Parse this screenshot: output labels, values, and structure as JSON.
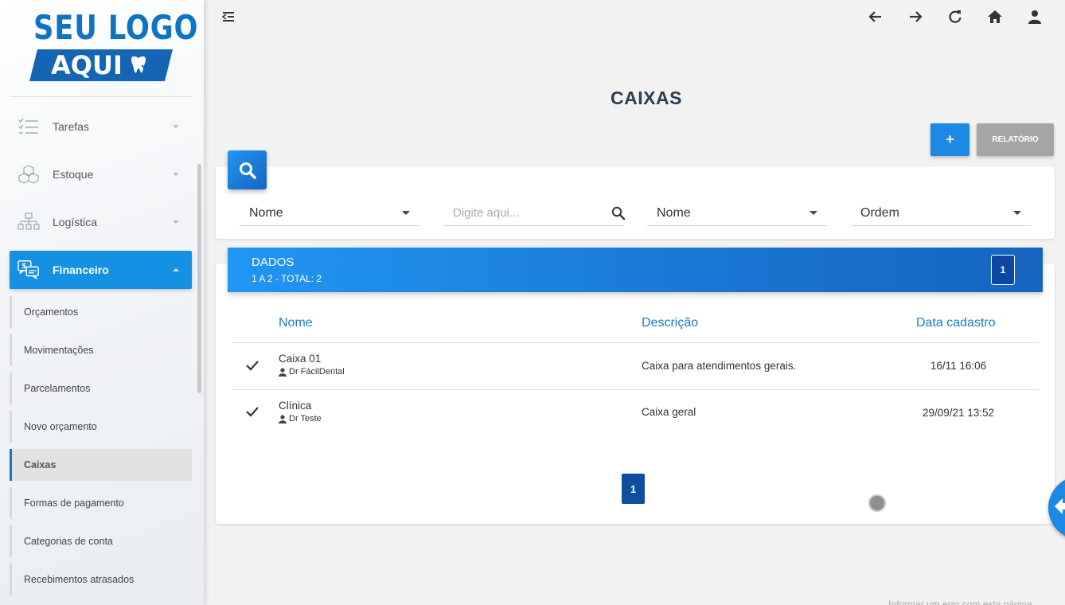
{
  "logo": {
    "line1": "SEU LOGO",
    "line2": "AQUI"
  },
  "sidebar": {
    "items": [
      {
        "label": "Tarefas",
        "icon": "checklist-icon"
      },
      {
        "label": "Estoque",
        "icon": "boxes-icon"
      },
      {
        "label": "Logística",
        "icon": "org-chart-icon"
      },
      {
        "label": "Financeiro",
        "icon": "finance-chat-icon",
        "active": true
      }
    ],
    "submenu": [
      "Orçamentos",
      "Movimentações",
      "Parcelamentos",
      "Novo orçamento",
      "Caixas",
      "Formas de pagamento",
      "Categorias de conta",
      "Recebimentos atrasados"
    ],
    "active_submenu": "Caixas"
  },
  "topbar": {
    "icons": [
      "menu-collapse-icon",
      "back-arrow-icon",
      "forward-arrow-icon",
      "refresh-icon",
      "home-icon",
      "user-icon"
    ]
  },
  "page": {
    "title": "CAIXAS",
    "add_label": "+",
    "report_label": "RELATÓRIO"
  },
  "filters": {
    "field1": "Nome",
    "search_placeholder": "Digite aqui...",
    "field2": "Nome",
    "order": "Ordem"
  },
  "data": {
    "header_title": "DADOS",
    "header_sub": "1 A 2 - TOTAL: 2",
    "page_indicator": "1",
    "columns": [
      "Nome",
      "Descrição",
      "Data cadastro"
    ],
    "rows": [
      {
        "name": "Caixa 01",
        "owner": "Dr FácilDental",
        "description": "Caixa para atendimentos gerais.",
        "date": "16/11 16:06"
      },
      {
        "name": "Clínica",
        "owner": "Dr Teste",
        "description": "Caixa geral",
        "date": "29/09/21 13:52"
      }
    ],
    "pager": "1"
  },
  "footer": {
    "link": "Informar um erro com esta página"
  },
  "colors": {
    "primary": "#1e88e5",
    "dark_primary": "#0d4f9e",
    "accent_text": "#1a7bc9",
    "gray_button": "#a5a5a5"
  }
}
